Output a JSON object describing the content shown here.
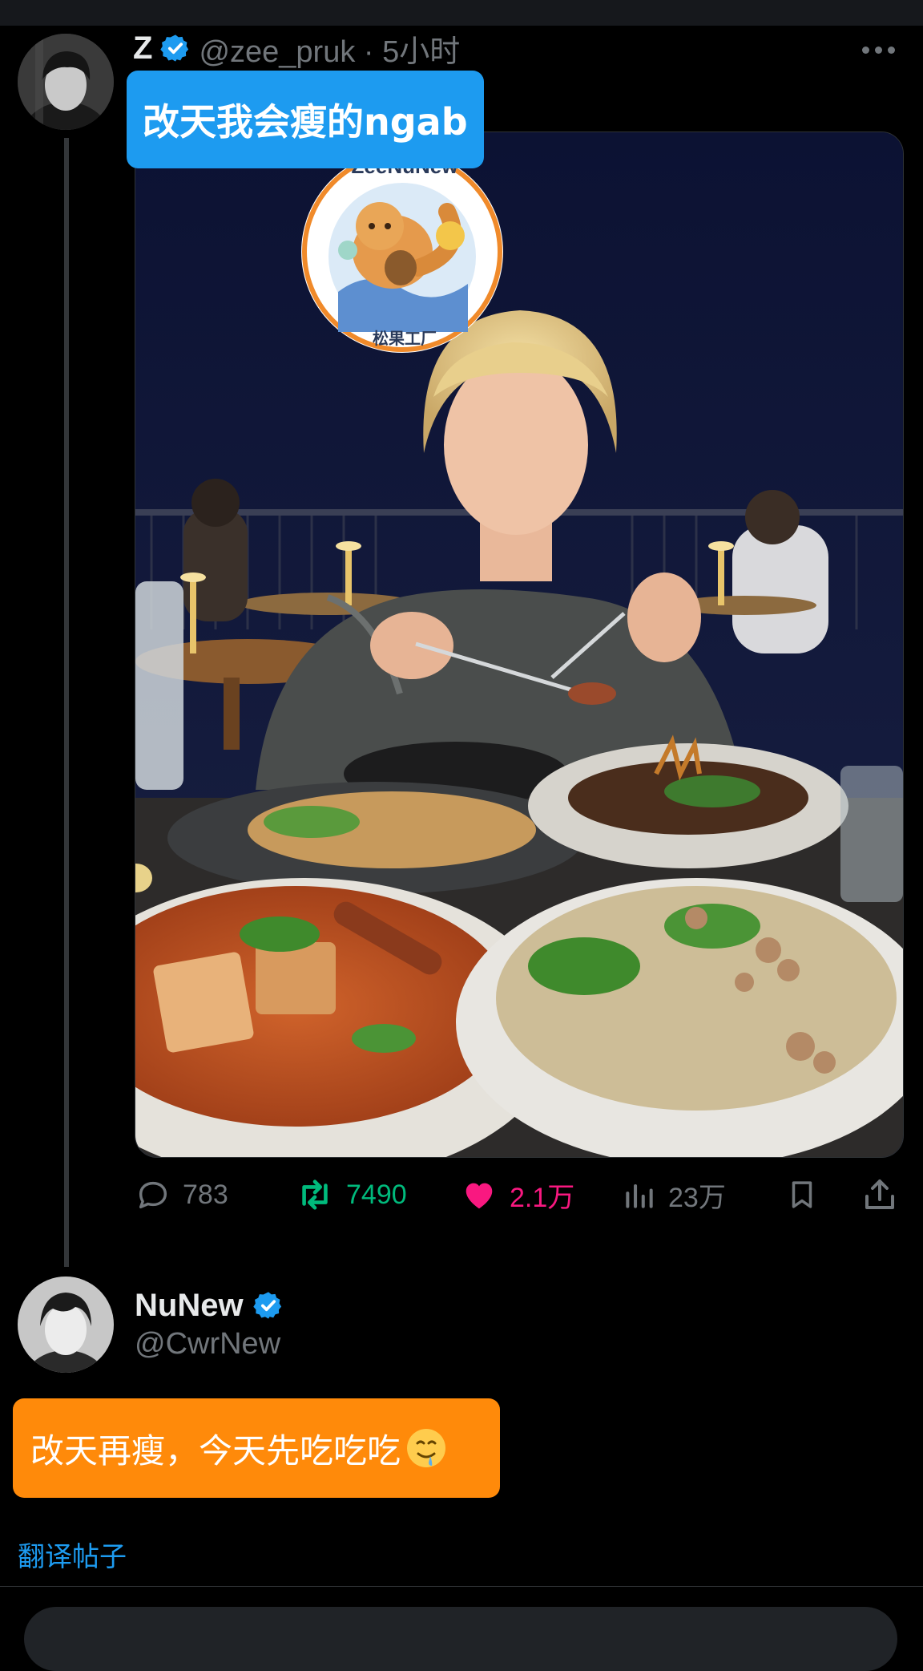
{
  "post": {
    "author_name": "Z",
    "handle_time": "@zee_pruk · 5小时",
    "caption": "改天我会瘦的ngab",
    "watermark": {
      "top_text": "ZeeNuNew",
      "bottom_text": "松果工厂"
    },
    "metrics": {
      "replies": "783",
      "reposts": "7490",
      "likes": "2.1万",
      "views": "23万"
    },
    "icons": {
      "reply": "comment-bubble-icon",
      "repost": "repost-arrows-icon",
      "like": "heart-icon",
      "views": "bar-chart-icon",
      "bookmark": "bookmark-icon",
      "share": "share-upload-icon",
      "more": "more-dots-icon",
      "verified": "verified-badge-icon"
    },
    "colors": {
      "caption_bg": "#1d9bf0",
      "repost": "#00ba7c",
      "like": "#f91880"
    }
  },
  "quoted_post": {
    "author_name": "NuNew",
    "handle": "@CwrNew",
    "caption": "改天再瘦，今天先吃吃吃",
    "emoji": "drooling-face-icon",
    "translate_link": "翻译帖子",
    "colors": {
      "caption_bg": "#ff8a0a"
    }
  }
}
